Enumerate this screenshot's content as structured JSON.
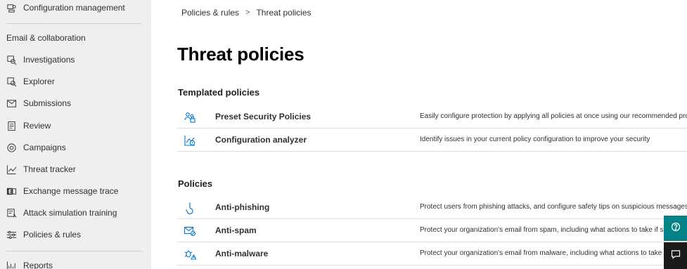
{
  "sidebar": {
    "top_item": {
      "label": "Configuration management",
      "icon": "settings-sliders-icon"
    },
    "section_header": "Email & collaboration",
    "items": [
      {
        "label": "Investigations",
        "icon": "investigations-icon"
      },
      {
        "label": "Explorer",
        "icon": "explorer-icon"
      },
      {
        "label": "Submissions",
        "icon": "submissions-icon"
      },
      {
        "label": "Review",
        "icon": "review-icon"
      },
      {
        "label": "Campaigns",
        "icon": "campaigns-icon"
      },
      {
        "label": "Threat tracker",
        "icon": "threat-tracker-icon"
      },
      {
        "label": "Exchange message trace",
        "icon": "exchange-icon"
      },
      {
        "label": "Attack simulation training",
        "icon": "attack-simulation-icon"
      },
      {
        "label": "Policies & rules",
        "icon": "policies-icon"
      }
    ],
    "bottom_item": {
      "label": "Reports",
      "icon": "reports-icon"
    }
  },
  "breadcrumb": {
    "parent": "Policies & rules",
    "separator": ">",
    "current": "Threat policies"
  },
  "page_title": "Threat policies",
  "templated": {
    "title": "Templated policies",
    "rows": [
      {
        "name": "Preset Security Policies",
        "desc": "Easily configure protection by applying all policies at once using our recommended protection",
        "icon": "preset-security-icon"
      },
      {
        "name": "Configuration analyzer",
        "desc": "Identify issues in your current policy configuration to improve your security",
        "icon": "configuration-analyzer-icon"
      }
    ]
  },
  "policies": {
    "title": "Policies",
    "rows": [
      {
        "name": "Anti-phishing",
        "desc": "Protect users from phishing attacks, and configure safety tips on suspicious messages.",
        "icon": "anti-phishing-icon"
      },
      {
        "name": "Anti-spam",
        "desc": "Protect your organization's email from spam, including what actions to take if spam",
        "icon": "anti-spam-icon"
      },
      {
        "name": "Anti-malware",
        "desc": "Protect your organization's email from malware, including what actions to take and who",
        "icon": "anti-malware-icon"
      }
    ]
  },
  "floating": {
    "help_icon": "help-icon",
    "feedback_icon": "feedback-icon"
  },
  "colors": {
    "accent": "#0078d4",
    "sidebar_bg": "#efefef",
    "help_bg": "#038387",
    "feedback_bg": "#1b1a19"
  }
}
